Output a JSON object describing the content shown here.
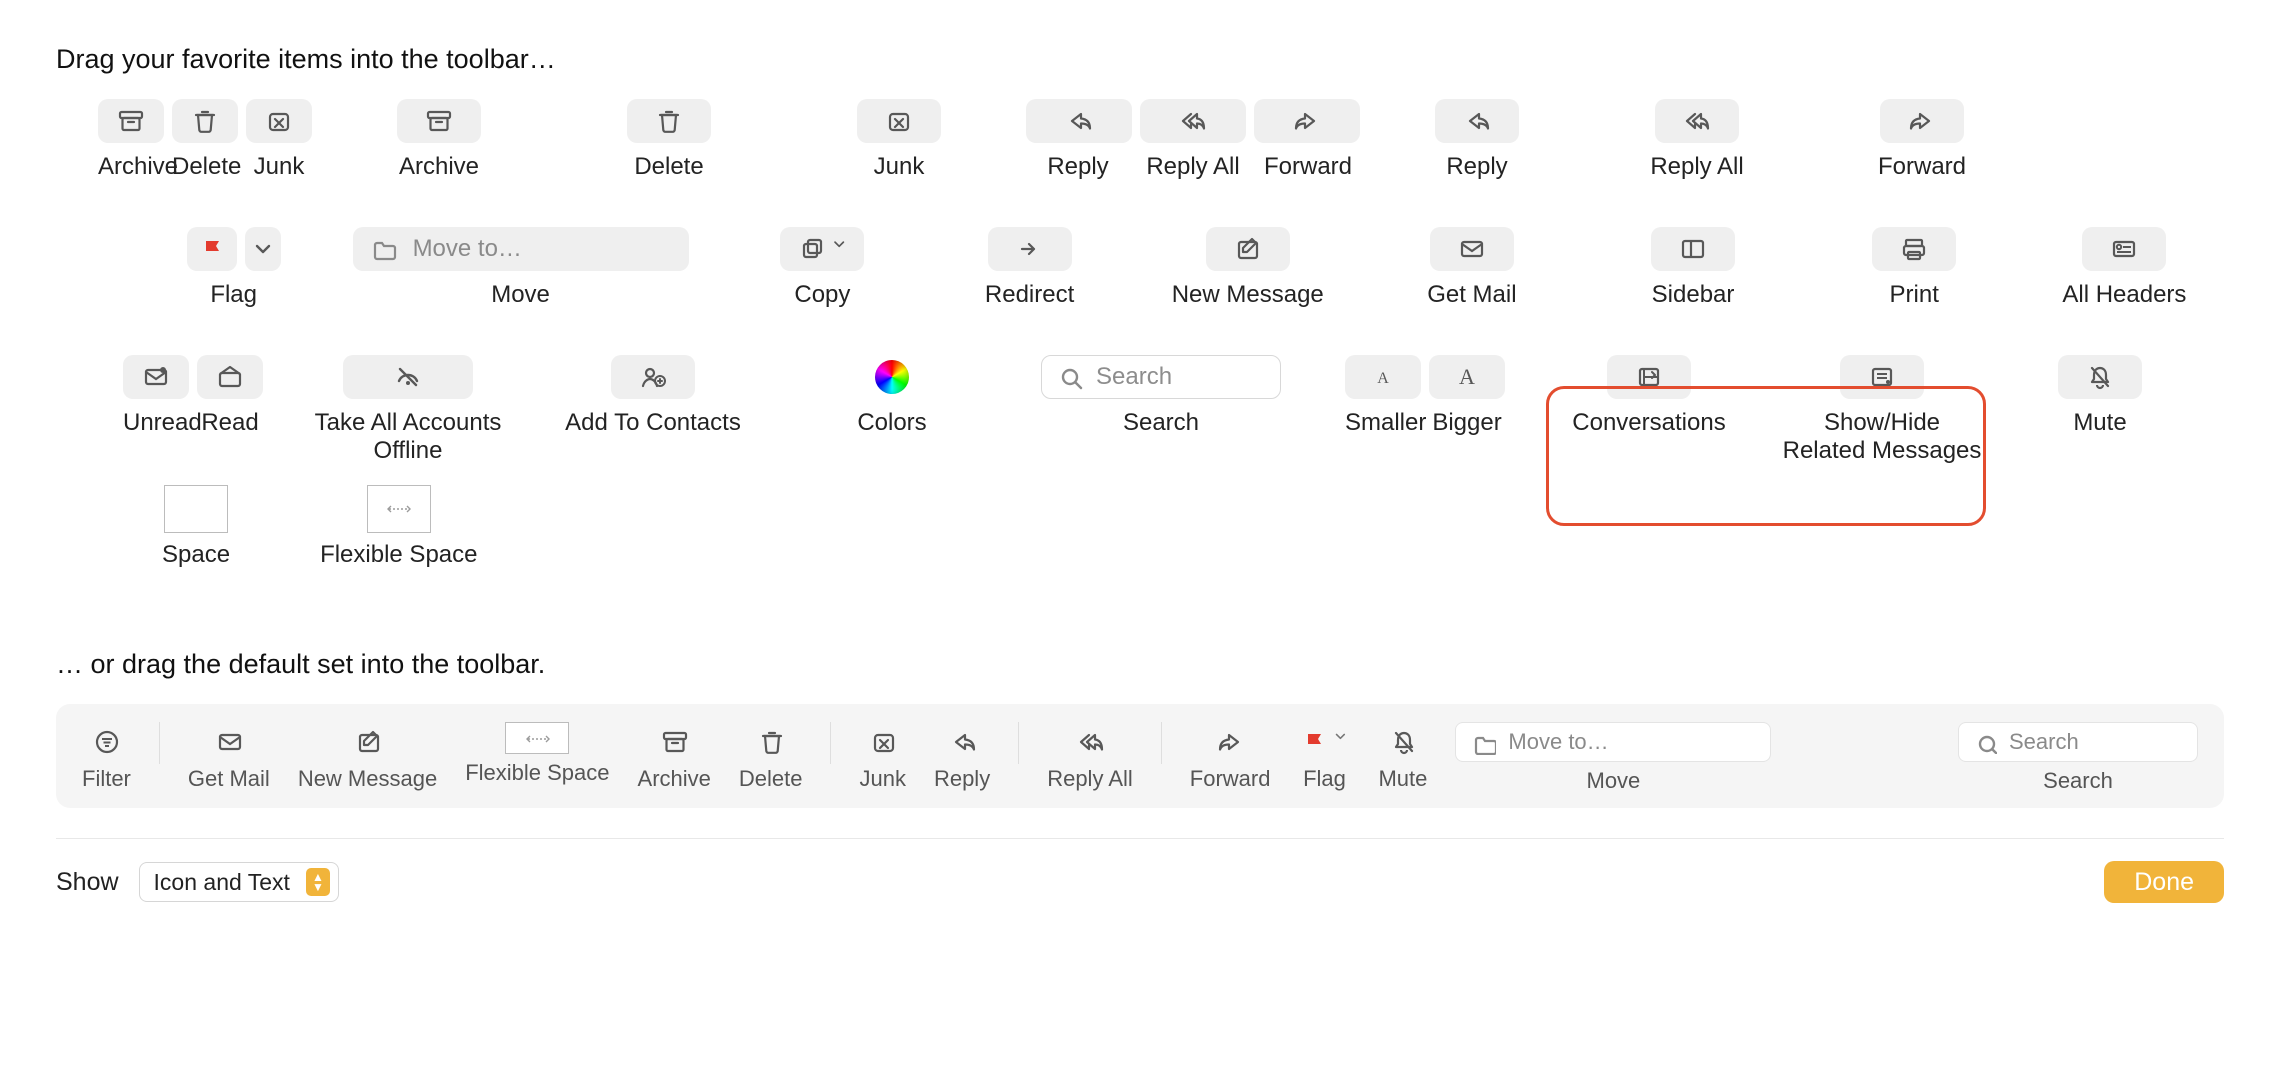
{
  "instruction_top": "Drag your favorite items into the toolbar…",
  "instruction_default": "… or drag the default set into the toolbar.",
  "row1": {
    "archive": "Archive",
    "delete": "Delete",
    "junk": "Junk",
    "archive2": "Archive",
    "delete2": "Delete",
    "junk2": "Junk",
    "reply": "Reply",
    "reply_all": "Reply All",
    "forward": "Forward",
    "reply2": "Reply",
    "reply_all2": "Reply All",
    "forward2": "Forward"
  },
  "row2": {
    "flag": "Flag",
    "move": "Move",
    "move_placeholder": "Move to…",
    "copy": "Copy",
    "redirect": "Redirect",
    "new_message": "New Message",
    "get_mail": "Get Mail",
    "sidebar": "Sidebar",
    "print": "Print",
    "all_headers": "All Headers"
  },
  "row3": {
    "unread": "Unread",
    "read": "Read",
    "offline": "Take All Accounts\nOffline",
    "add_contacts": "Add To Contacts",
    "colors": "Colors",
    "search": "Search",
    "search_placeholder": "Search",
    "smaller": "Smaller",
    "bigger": "Bigger",
    "conversations": "Conversations",
    "show_hide": "Show/Hide\nRelated Messages",
    "mute": "Mute"
  },
  "row4": {
    "space": "Space",
    "flexible_space": "Flexible Space"
  },
  "default_toolbar": {
    "filter": "Filter",
    "get_mail": "Get Mail",
    "new_message": "New Message",
    "flexible_space": "Flexible Space",
    "archive": "Archive",
    "delete": "Delete",
    "junk": "Junk",
    "reply": "Reply",
    "reply_all": "Reply All",
    "forward": "Forward",
    "flag": "Flag",
    "mute": "Mute",
    "move": "Move",
    "move_placeholder": "Move to…",
    "search": "Search",
    "search_placeholder": "Search"
  },
  "footer": {
    "show": "Show",
    "select_value": "Icon and Text",
    "done": "Done"
  }
}
